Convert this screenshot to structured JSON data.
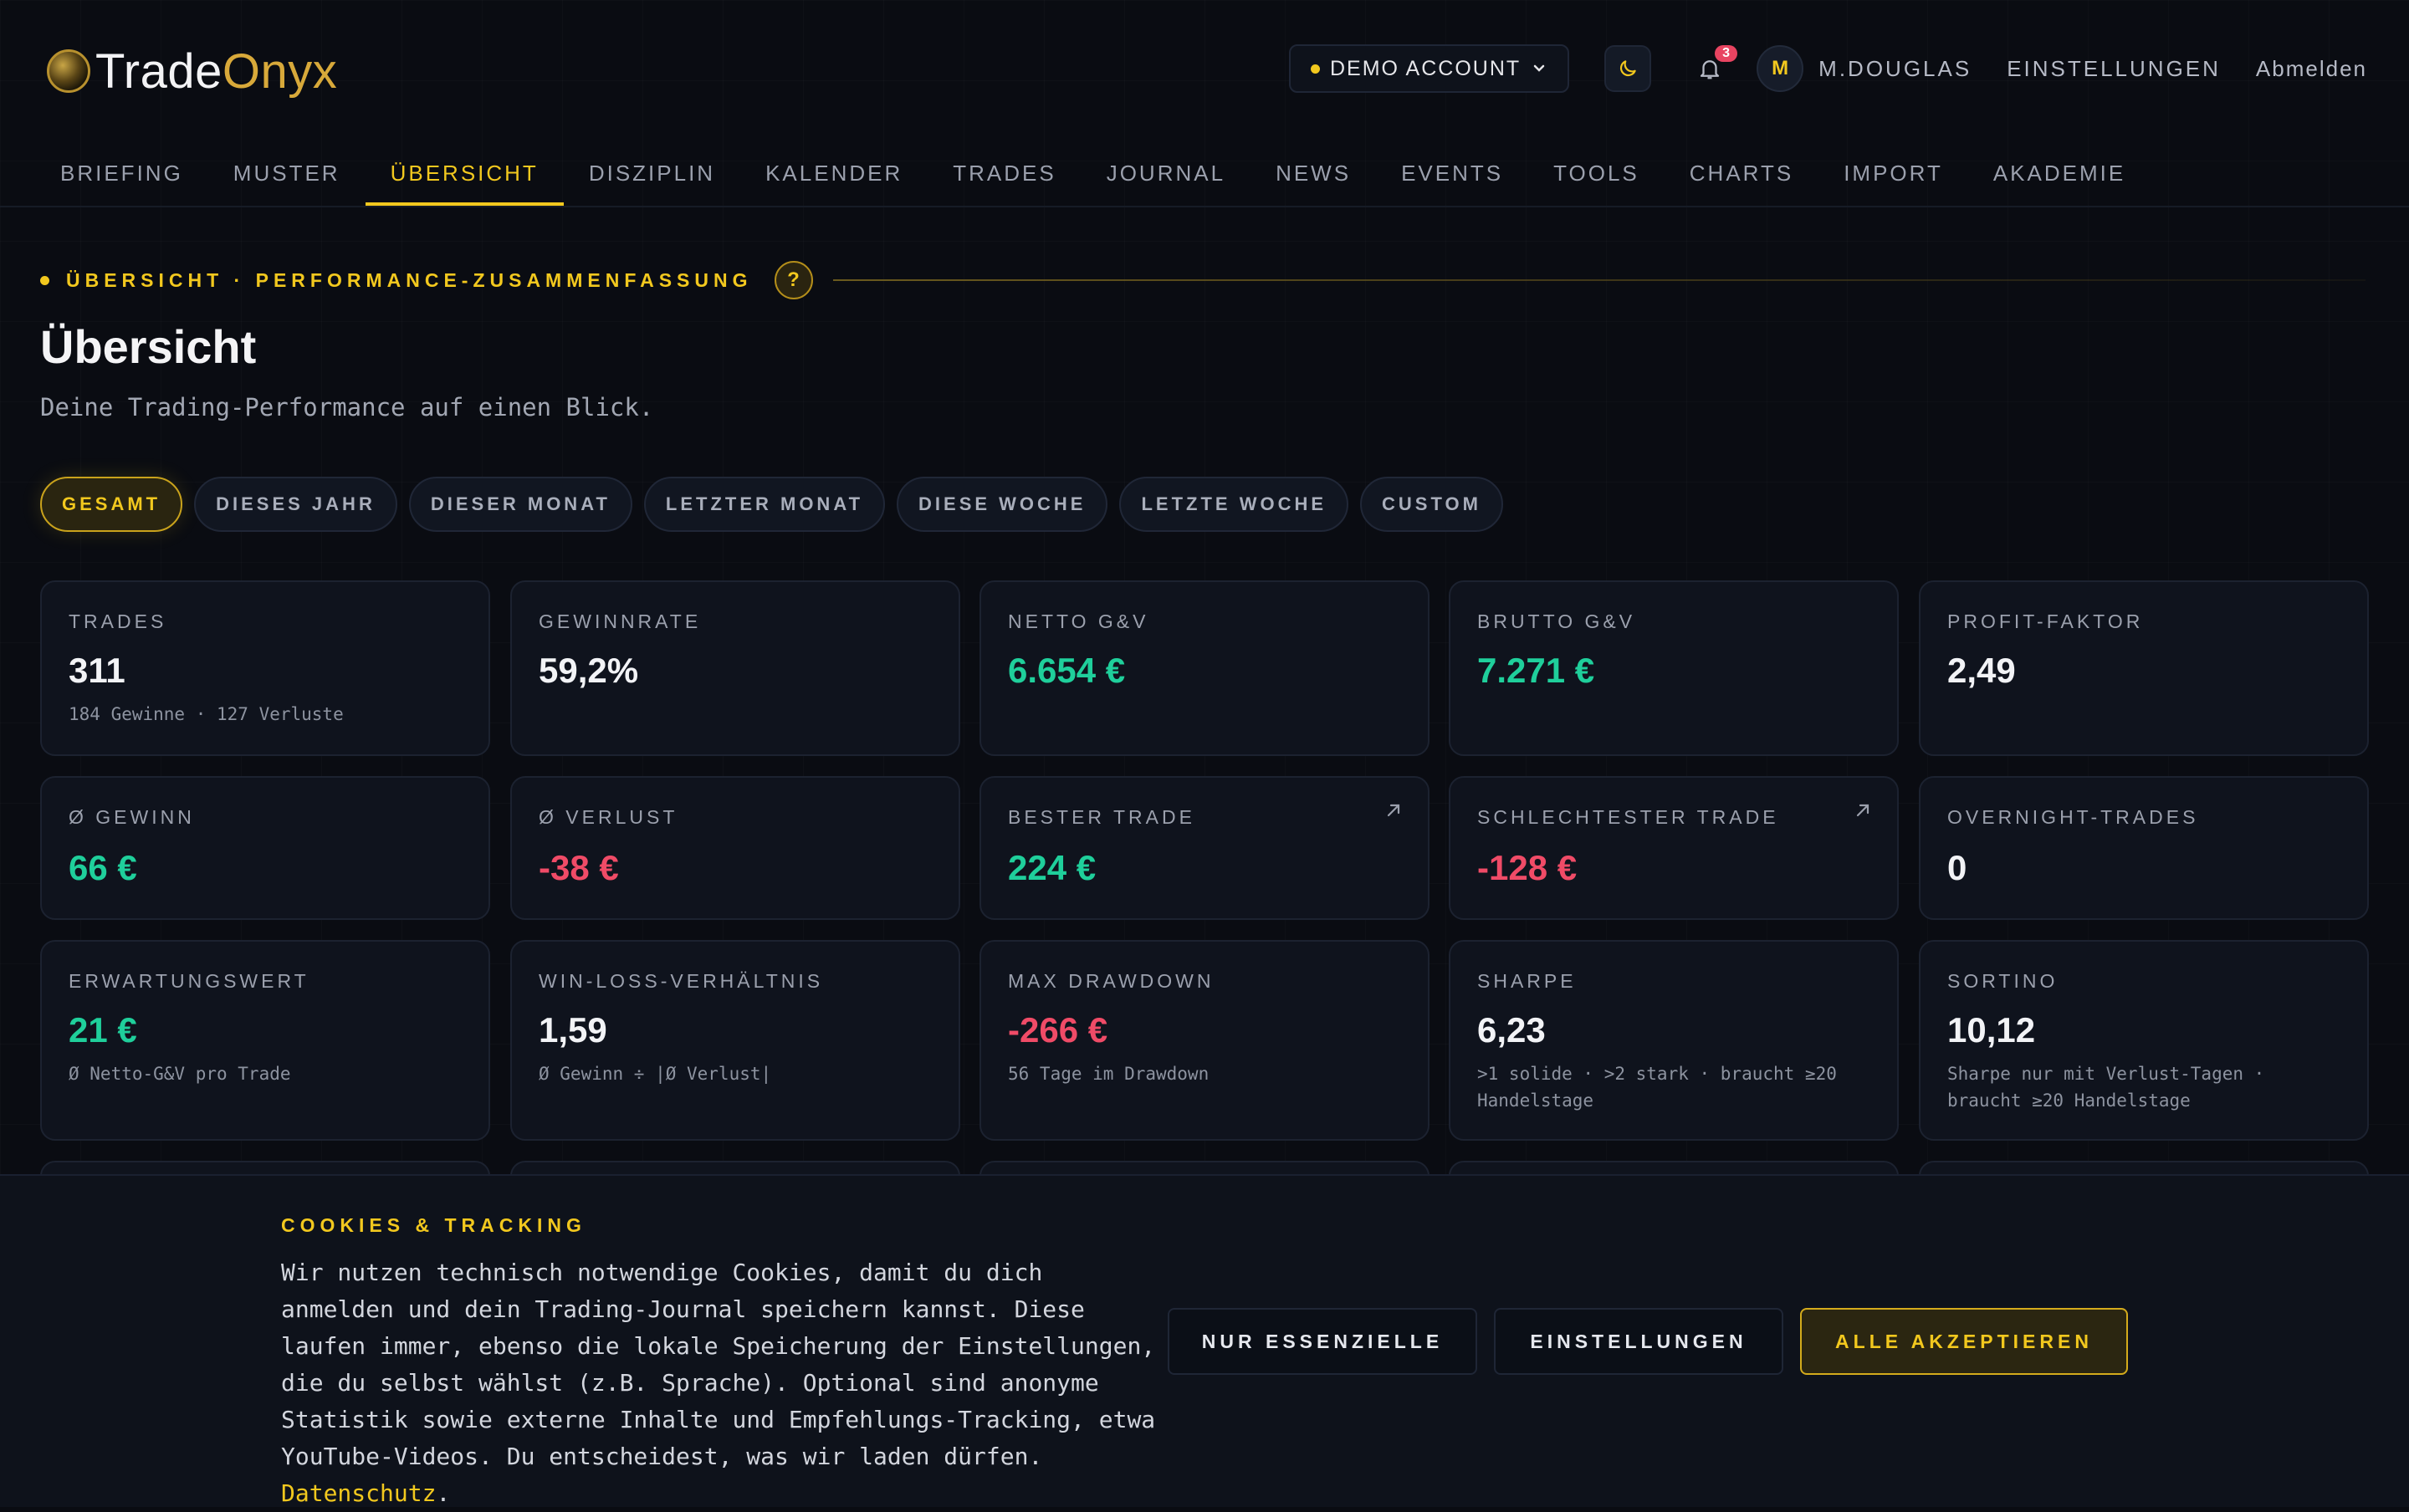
{
  "header": {
    "logo": {
      "part1": "Trade",
      "part2": "Onyx"
    },
    "account_label": "DEMO ACCOUNT",
    "notification_count": "3",
    "avatar_initial": "M",
    "username": "M.DOUGLAS",
    "settings_label": "EINSTELLUNGEN",
    "logout_label": "Abmelden"
  },
  "nav": {
    "items": [
      "BRIEFING",
      "MUSTER",
      "ÜBERSICHT",
      "DISZIPLIN",
      "KALENDER",
      "TRADES",
      "JOURNAL",
      "NEWS",
      "EVENTS",
      "TOOLS",
      "CHARTS",
      "IMPORT",
      "AKADEMIE"
    ],
    "active": "ÜBERSICHT"
  },
  "section": {
    "label": "ÜBERSICHT · PERFORMANCE-ZUSAMMENFASSUNG",
    "help": "?",
    "title": "Übersicht",
    "subtitle": "Deine Trading-Performance auf einen Blick."
  },
  "filters": {
    "items": [
      "GESAMT",
      "DIESES JAHR",
      "DIESER MONAT",
      "LETZTER MONAT",
      "DIESE WOCHE",
      "LETZTE WOCHE",
      "CUSTOM"
    ],
    "active": "GESAMT"
  },
  "metrics": {
    "trades": {
      "label": "TRADES",
      "value": "311",
      "sub": "184 Gewinne · 127 Verluste"
    },
    "winrate": {
      "label": "GEWINNRATE",
      "value": "59,2%"
    },
    "net_pnl": {
      "label": "NETTO G&V",
      "value": "6.654 €"
    },
    "gross_pnl": {
      "label": "BRUTTO G&V",
      "value": "7.271 €"
    },
    "profit_factor": {
      "label": "PROFIT-FAKTOR",
      "value": "2,49"
    },
    "avg_win": {
      "label": "Ø GEWINN",
      "value": "66 €"
    },
    "avg_loss": {
      "label": "Ø VERLUST",
      "value": "-38 €"
    },
    "best_trade": {
      "label": "BESTER TRADE",
      "value": "224 €"
    },
    "worst_trade": {
      "label": "SCHLECHTESTER TRADE",
      "value": "-128 €"
    },
    "overnight": {
      "label": "OVERNIGHT-TRADES",
      "value": "0"
    },
    "expectancy": {
      "label": "ERWARTUNGSWERT",
      "value": "21 €",
      "sub": "Ø Netto-G&V pro Trade"
    },
    "winloss": {
      "label": "WIN-LOSS-VERHÄLTNIS",
      "value": "1,59",
      "sub": "Ø Gewinn ÷ |Ø Verlust|"
    },
    "drawdown": {
      "label": "MAX DRAWDOWN",
      "value": "-266 €",
      "sub": "56 Tage im Drawdown"
    },
    "sharpe": {
      "label": "SHARPE",
      "value": "6,23",
      "sub": ">1 solide · >2 stark · braucht ≥20 Handelstage"
    },
    "sortino": {
      "label": "SORTINO",
      "value": "10,12",
      "sub": "Sharpe nur mit Verlust-Tagen · braucht ≥20 Handelstage"
    }
  },
  "cookie": {
    "title": "COOKIES & TRACKING",
    "text": "Wir nutzen technisch notwendige Cookies, damit du dich anmelden und dein Trading-Journal speichern kannst. Diese laufen immer, ebenso die lokale Speicherung der Einstellungen, die du selbst wählst (z.B. Sprache). Optional sind anonyme Statistik sowie externe Inhalte und Empfehlungs-Tracking, etwa YouTube-Videos. Du entscheidest, was wir laden dürfen.",
    "link": "Datenschutz",
    "period": ".",
    "btn_essential": "NUR ESSENZIELLE",
    "btn_settings": "EINSTELLUNGEN",
    "btn_accept": "ALLE AKZEPTIEREN"
  },
  "colors": {
    "accent": "#f2c81e",
    "positive": "#1fcf9b",
    "negative": "#f04b67",
    "background": "#0a0c12"
  }
}
